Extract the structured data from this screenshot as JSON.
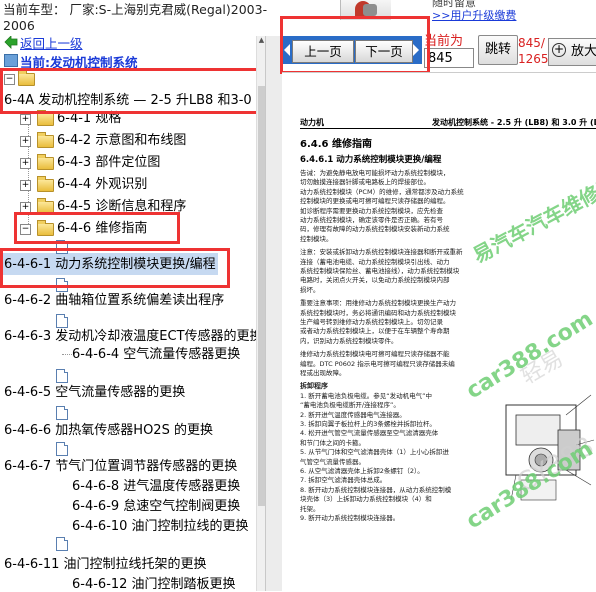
{
  "header": {
    "vehicle_label": "当前车型： 厂家:S-上海别克君威(Regal)2003-",
    "vehicle_label_cont": "2006",
    "promo_text": "随时留意",
    "promo_link": ">>用户升级缴费"
  },
  "sidebar": {
    "back_label": "返回上一级",
    "current_path": "当前:发动机控制系统",
    "root_section": "6-4A 发动机控制系统 — 2-5 升LB8 和3-0 升",
    "items": [
      {
        "label": "6-4-1 规格"
      },
      {
        "label": "6-4-2 示意图和布线图"
      },
      {
        "label": "6-4-3 部件定位图"
      },
      {
        "label": "6-4-4 外观识别"
      },
      {
        "label": "6-4-5 诊断信息和程序"
      },
      {
        "label": "6-4-6 维修指南"
      }
    ],
    "docs": [
      {
        "label": "6-4-6-1 动力系统控制模块更换/编程"
      },
      {
        "label": "6-4-6-2 曲轴箱位置系统偏差读出程序"
      },
      {
        "label": "6-4-6-3 发动机冷却液温度ECT传感器的更换"
      },
      {
        "label": "6-4-6-4 空气流量传感器更换"
      },
      {
        "label": "6-4-6-5 空气流量传感器的更换"
      },
      {
        "label": "6-4-6-6 加热氧传感器HO2S 的更换"
      },
      {
        "label": "6-4-6-7 节气门位置调节器传感器的更换"
      },
      {
        "label": "6-4-6-8 进气温度传感器更换"
      },
      {
        "label": "6-4-6-9 怠速空气控制阀更换"
      },
      {
        "label": "6-4-6-10 油门控制拉线的更换"
      },
      {
        "label": "6-4-6-11 油门控制拉线托架的更换"
      },
      {
        "label": "6-4-6-12 油门控制踏板更换"
      }
    ]
  },
  "toolbar": {
    "prev_label": "上一页",
    "next_label": "下一页",
    "current_label": "当前为",
    "page_value": "845",
    "jump_label": "跳转",
    "page_count_line1": "845/",
    "page_count_line2": "1265",
    "zoom_label": "放大"
  },
  "document": {
    "header_left": "动力机",
    "header_right": "发动机控制系统 - 2.5 升 (LB8) 和 3.0 升 (L",
    "title": "6.4.6 维修指南",
    "subtitle": "6.4.6.1 动力系统控制模块更换/编程",
    "paragraphs": [
      "告诫：为避免静电放电可能损坏动力系统控制模块，",
      "切勿触摸连接器针脚或电路板上的焊接部位。",
      "动力系统控制模块（PCM）的维修，通常都涉及动力系统",
      "控制模块的更换或电可擦可编程只读存储器的编程。",
      "如诊断程序需要更换动力系统控制模块，应先检查",
      "动力系统控制模块，确定该零件是否正确。若有号",
      "码，修理有故障的动力系统控制模块安装新动力系统",
      "控制模块。",
      "注意：安装或拆卸动力系统控制模块连接器和断开或重新",
      "连接（蓄电池电缆、动力系统控制模块引出线、动力",
      "系统控制模块保险丝、蓄电池接线），动力系统控制模块",
      "电路时，关闭点火开关，以免动力系统控制模块内部",
      "损坏。",
      "重要注意事项：用维修动力系统控制模块更换生产动力",
      "系统控制模块时，务必将通讯编码和动力系统控制模块",
      "生产编号转到维修动力系统控制模块上。切勿记录",
      "或者动力系统控制模块上，以便于在车辆整个寿命期",
      "内，识别动力系统控制模块零件。",
      "维修动力系统控制模块电可擦可编程只读存储器不能",
      "编程。DTC P0602 指示电可擦可编程只读存储器未编",
      "程或出现故障。",
      "拆卸程序",
      "1. 断开蓄电池负极电缆。参见“发动机电气”中",
      "   “蓄电池负极电缆断开/连接程序”。",
      "2. 断开进气温度传感器电气连接器。",
      "3. 拆卸向翼子板拉杆上的3条螺栓并拆卸拉杆。",
      "4. 松开进气管空气流量传感器至空气滤清器壳体",
      "   和节门体之间的卡箍。",
      "5. 从节气门体和空气滤清器壳体（1）上小心拆卸进",
      "   气管空气流量传感器。",
      "6. 从空气滤清器壳体上拆卸2条螺钉（2）。",
      "7. 拆卸空气滤清器壳体总成。",
      "8. 断开动力系统控制模块连接器，从动力系统控制模",
      "   块壳体（3）上拆卸动力系统控制模块（4）和",
      "   托架。",
      "9. 断开动力系统控制模块连接器。"
    ],
    "watermarks": {
      "platform": "汽车维修平台",
      "site_a": "car388.com",
      "site_b": "car388.com",
      "faint_a": "轻易",
      "faint_b": "CY388"
    },
    "watermark_brand": "易汽车"
  }
}
